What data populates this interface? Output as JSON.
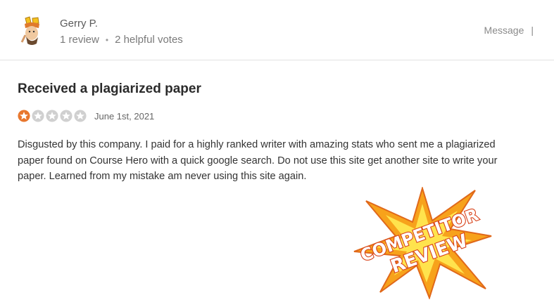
{
  "reviewer": {
    "name": "Gerry P.",
    "review_count": "1 review",
    "helpful_votes": "2 helpful votes",
    "separator": "•",
    "avatar_icon": "cartoon-avatar-icon"
  },
  "actions": {
    "message_label": "Message",
    "divider": "|"
  },
  "review": {
    "title": "Received a plagiarized paper",
    "rating": 1,
    "max_rating": 5,
    "date": "June 1st, 2021",
    "body": "Disgusted by this company. I paid for a highly ranked writer with amazing stats who sent me a plagiarized paper found on Course Hero with a quick google search. Do not use this site get another site to write your paper. Learned from my mistake am never using this site again."
  },
  "badge": {
    "line1": "COMPETITOR",
    "line2": "REVIEW",
    "colors": {
      "burst_outer": "#f7a21b",
      "burst_inner": "#ffe34d",
      "text_fill": "#ffffff",
      "text_stroke": "#d8421a"
    }
  },
  "colors": {
    "star_active": "#e8772e",
    "star_inactive": "#d0d0d0",
    "divider": "#e2e2e2"
  }
}
